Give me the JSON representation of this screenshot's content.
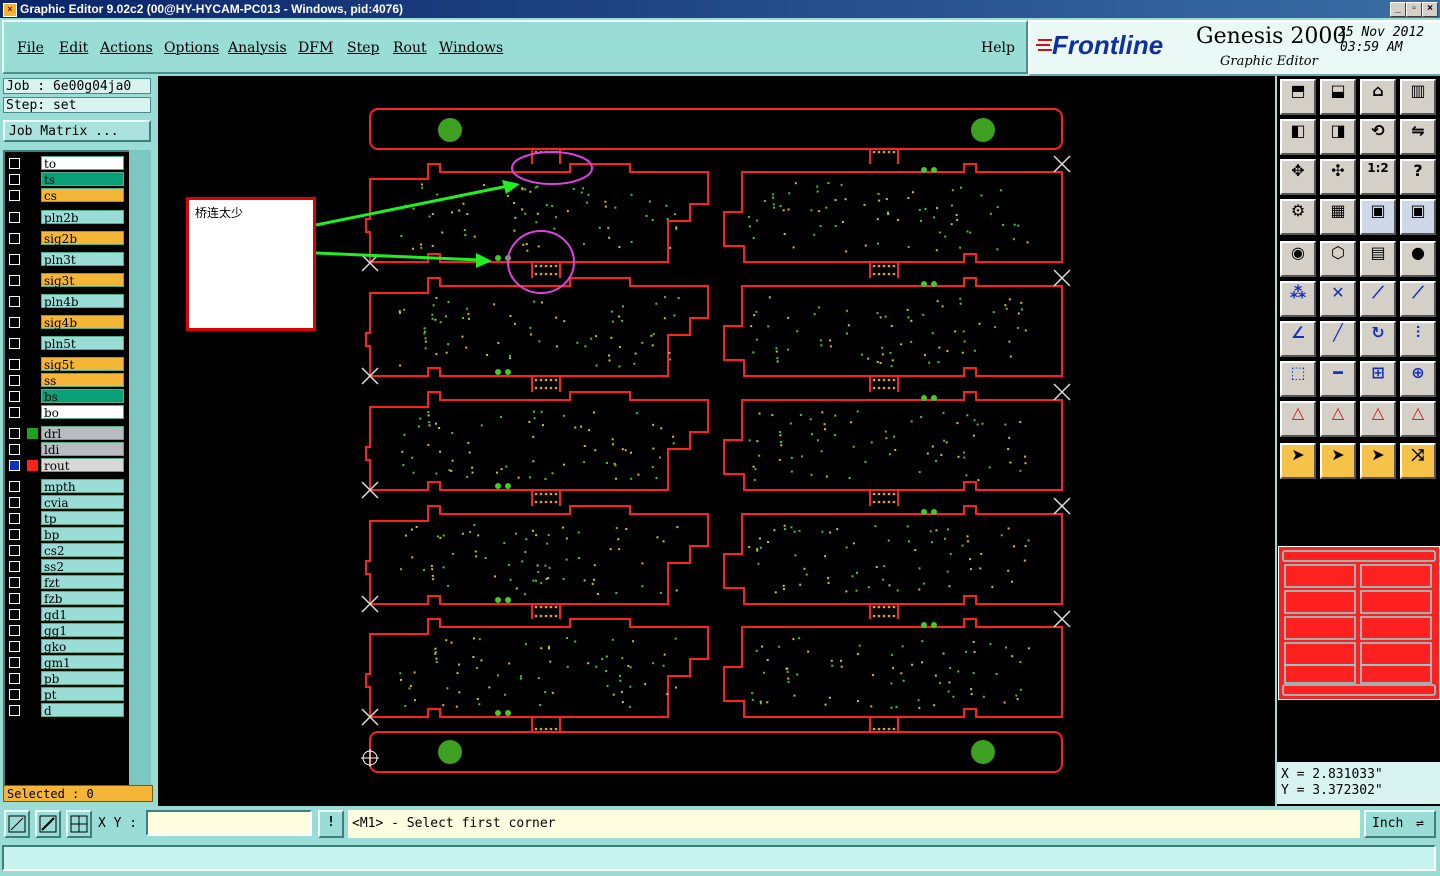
{
  "window": {
    "title": "Graphic Editor 9.02c2 (00@HY-HYCAM-PC013 - Windows, pid:4076)",
    "controls": [
      "_",
      "▫",
      "×"
    ]
  },
  "menu": {
    "items": [
      "File",
      "Edit",
      "Actions",
      "Options",
      "Analysis",
      "DFM",
      "Step",
      "Rout",
      "Windows"
    ],
    "help": "Help"
  },
  "brand": {
    "logo": "Frontline",
    "product": "Genesis 2000",
    "subtitle": "Graphic Editor",
    "date": "25 Nov 2012",
    "time": "03:59 AM"
  },
  "job": {
    "job_label": "Job : 6e00g04ja0",
    "step_label": "Step: set",
    "matrix_button": "Job Matrix ..."
  },
  "layers": [
    {
      "name": "to",
      "color": "#ffffff"
    },
    {
      "name": "ts",
      "color": "#0aa07a"
    },
    {
      "name": "cs",
      "color": "#f5b638"
    },
    {
      "name": "pln2b",
      "color": "#9adcd6"
    },
    {
      "name": "sig2b",
      "color": "#f5b638"
    },
    {
      "name": "pln3t",
      "color": "#9adcd6"
    },
    {
      "name": "sig3t",
      "color": "#f5b638"
    },
    {
      "name": "pln4b",
      "color": "#9adcd6"
    },
    {
      "name": "sig4b",
      "color": "#f5b638"
    },
    {
      "name": "pln5t",
      "color": "#9adcd6"
    },
    {
      "name": "sig5t",
      "color": "#f5b638"
    },
    {
      "name": "ss",
      "color": "#f5b638"
    },
    {
      "name": "bs",
      "color": "#0aa07a"
    },
    {
      "name": "bo",
      "color": "#ffffff"
    },
    {
      "name": "drl",
      "color": "#b8bcc0"
    },
    {
      "name": "ldi",
      "color": "#b8bcc0"
    },
    {
      "name": "rout",
      "color": "#d8d8d8"
    },
    {
      "name": "mpth",
      "color": "#9adcd6"
    },
    {
      "name": "cvia",
      "color": "#9adcd6"
    },
    {
      "name": "tp",
      "color": "#9adcd6"
    },
    {
      "name": "bp",
      "color": "#9adcd6"
    },
    {
      "name": "cs2",
      "color": "#9adcd6"
    },
    {
      "name": "ss2",
      "color": "#9adcd6"
    },
    {
      "name": "fzt",
      "color": "#9adcd6"
    },
    {
      "name": "fzb",
      "color": "#9adcd6"
    },
    {
      "name": "gd1",
      "color": "#9adcd6"
    },
    {
      "name": "gg1",
      "color": "#9adcd6"
    },
    {
      "name": "gko",
      "color": "#9adcd6"
    },
    {
      "name": "gm1",
      "color": "#9adcd6"
    },
    {
      "name": "pb",
      "color": "#9adcd6"
    },
    {
      "name": "pt",
      "color": "#9adcd6"
    },
    {
      "name": "d",
      "color": "#9adcd6"
    }
  ],
  "selected": "Selected : 0",
  "annotation": {
    "text": "桥连太少"
  },
  "coordinates": {
    "x": "X = 2.831033\"",
    "y": "Y = 3.372302\""
  },
  "bottom": {
    "xy_label": "X Y :",
    "xy_value": "",
    "info_button": "!",
    "prompt": "<M1> - Select first corner",
    "units": "Inch"
  },
  "colors": {
    "rout": "#ff2020",
    "pads": "#44cc22",
    "dots": "#d8c020",
    "arrow": "#22ee22",
    "highlight": "#e040e0"
  }
}
